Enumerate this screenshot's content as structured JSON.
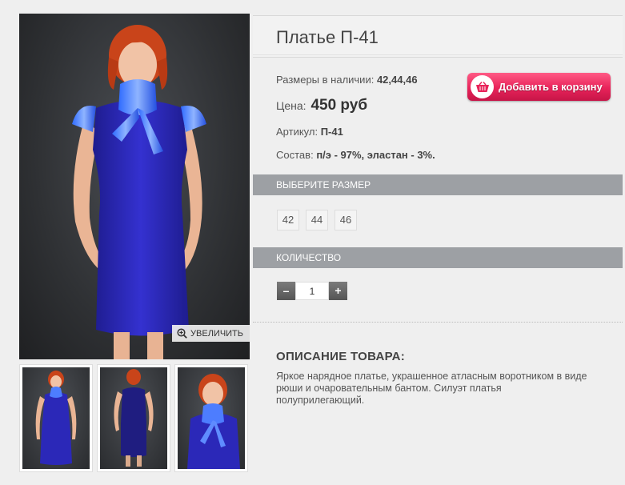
{
  "product": {
    "title": "Платье П-41",
    "sizes_label": "Размеры в наличии:",
    "sizes_value": "42,44,46",
    "price_label": "Цена:",
    "price_value": "450 руб",
    "sku_label": "Артикул:",
    "sku_value": "П-41",
    "composition_label": "Состав:",
    "composition_value": "п/э - 97%, эластан - 3%."
  },
  "cart": {
    "button_label": "Добавить в корзину",
    "icon": "basket-icon"
  },
  "gallery": {
    "zoom_label": "УВЕЛИЧИТЬ",
    "zoom_icon": "magnifier-plus-icon",
    "thumbnails": [
      "front-view",
      "back-view",
      "close-up"
    ]
  },
  "size_section": {
    "header": "ВЫБЕРИТЕ РАЗМЕР",
    "options": [
      "42",
      "44",
      "46"
    ]
  },
  "quantity_section": {
    "header": "КОЛИЧЕСТВО",
    "value": "1",
    "minus": "–",
    "plus": "+"
  },
  "description": {
    "title": "ОПИСАНИЕ ТОВАРА:",
    "text": "Яркое нарядное платье, украшенное атласным воротником в виде рюши и очаровательным бантом. Силуэт платья полуприлегающий."
  },
  "colors": {
    "accent": "#e8235a",
    "dress": "#2b28b8",
    "bar": "#9da0a4"
  }
}
